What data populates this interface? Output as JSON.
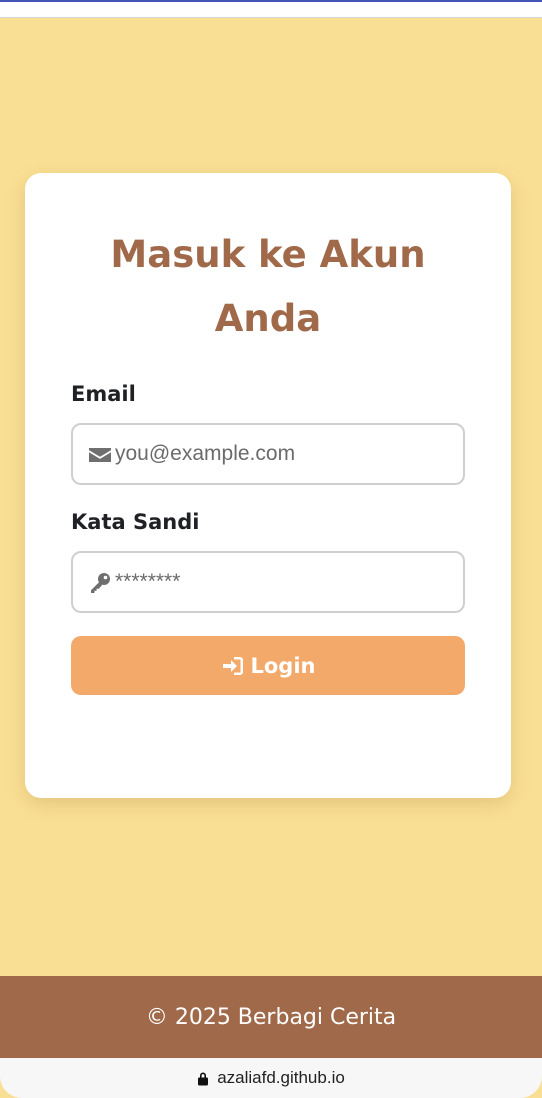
{
  "card": {
    "title": "Masuk ke Akun Anda"
  },
  "form": {
    "email_label": "Email",
    "email_placeholder": "you@example.com",
    "email_value": "",
    "password_label": "Kata Sandi",
    "password_placeholder": "********",
    "password_value": "",
    "login_label": "Login",
    "email_icon": "envelope-icon",
    "password_icon": "key-icon",
    "login_icon": "sign-in-icon"
  },
  "footer": {
    "text": "© 2025 Berbagi Cerita"
  },
  "browser": {
    "url": "azaliafd.github.io",
    "lock_icon": "lock-icon"
  },
  "colors": {
    "background": "#f9df94",
    "accent_brown": "#a0694a",
    "button_orange": "#f2a96a"
  }
}
